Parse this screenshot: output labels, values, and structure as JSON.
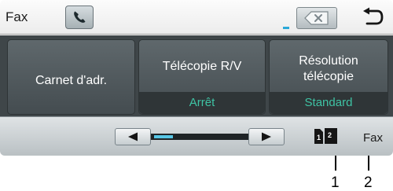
{
  "header": {
    "title": "Fax",
    "phone_icon": "phone-handset-icon",
    "backspace_icon": "backspace-icon",
    "back_icon": "back-arrow-icon"
  },
  "buttons": {
    "address_book": {
      "label": "Carnet d'adr."
    },
    "fax_tel": {
      "label": "Télécopie R/V",
      "value": "Arrêt"
    },
    "resolution": {
      "label_line1": "Résolution",
      "label_line2": "télécopie",
      "value": "Standard"
    }
  },
  "nav": {
    "left_icon": "left-arrow-icon",
    "right_icon": "right-arrow-icon",
    "scroll_position": 0.2
  },
  "status": {
    "duplex_left": "1",
    "duplex_right": "2",
    "mode_label": "Fax"
  },
  "callouts": [
    "1",
    "2"
  ],
  "colors": {
    "value_text": "#3fc3a4",
    "slider_fill": "#56c6e6",
    "panel_bg": "#3f4649",
    "cursor": "#2aa8d8"
  }
}
